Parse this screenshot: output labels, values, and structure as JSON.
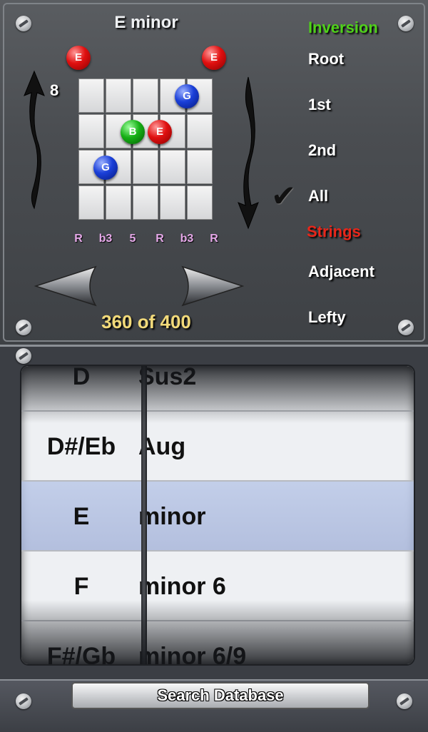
{
  "chord": {
    "title": "E minor",
    "fret_number": "8",
    "counter": "360 of 400"
  },
  "fretboard": {
    "open_markers": [
      {
        "string": 0,
        "label": "E",
        "color": "red"
      },
      {
        "string": 5,
        "label": "E",
        "color": "red"
      }
    ],
    "notes": [
      {
        "string": 4,
        "fret": 1,
        "label": "G",
        "color": "blue"
      },
      {
        "string": 2,
        "fret": 2,
        "label": "B",
        "color": "green"
      },
      {
        "string": 3,
        "fret": 2,
        "label": "E",
        "color": "red"
      },
      {
        "string": 1,
        "fret": 3,
        "label": "G",
        "color": "blue"
      }
    ],
    "intervals": [
      "R",
      "b3",
      "5",
      "R",
      "b3",
      "R"
    ]
  },
  "menu": {
    "inversion_header": "Inversion",
    "root": "Root",
    "first": "1st",
    "second": "2nd",
    "all": "All",
    "strings_header": "Strings",
    "adjacent": "Adjacent",
    "lefty": "Lefty",
    "checkmark": "✔"
  },
  "colors": {
    "inversion_header": "#4fd11a",
    "strings_header": "#e8261a",
    "counter": "#f2da7a",
    "intervals": "#e5a8e8"
  },
  "picker": {
    "rows": [
      {
        "root": "D",
        "type": "Sus2"
      },
      {
        "root": "D#/Eb",
        "type": "Aug"
      },
      {
        "root": "E",
        "type": "minor"
      },
      {
        "root": "F",
        "type": "minor 6"
      },
      {
        "root": "F#/Gb",
        "type": "minor 6/9"
      }
    ],
    "selected_index": 2
  },
  "search_button": "Search Database"
}
